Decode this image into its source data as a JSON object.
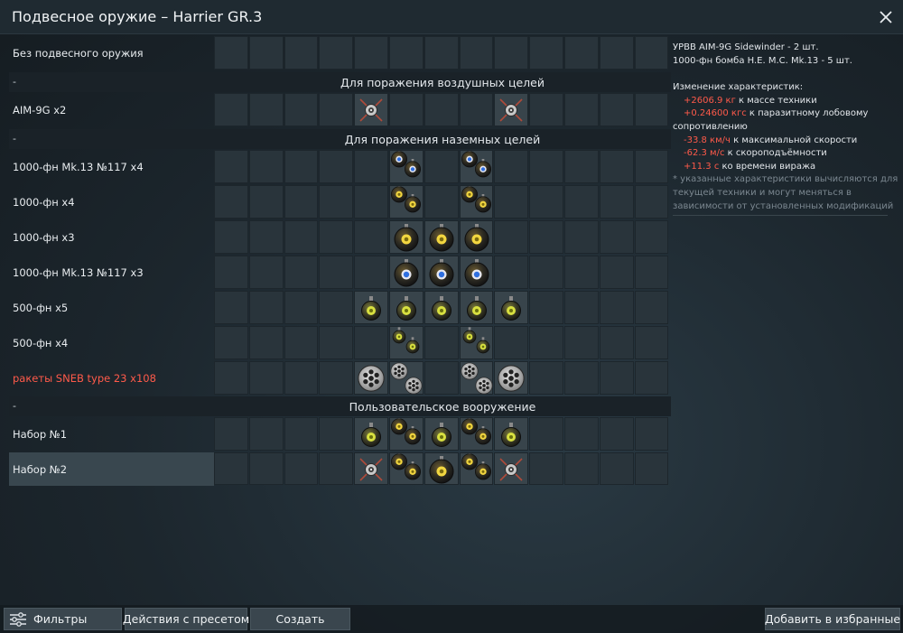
{
  "window": {
    "title": "Подвесное оружие – Harrier GR.3"
  },
  "rows": {
    "no_weapons": "Без подвесного оружия",
    "dash1": "-",
    "section_air": "Для поражения воздушных целей",
    "aim9g": "AIM-9G x2",
    "dash2": "-",
    "section_ground": "Для поражения наземных целей",
    "mk13_117_x4": "1000-фн Mk.13 №117 x4",
    "b1000_x4": "1000-фн x4",
    "b1000_x3": "1000-фн x3",
    "mk13_117_x3": "1000-фн Mk.13 №117 x3",
    "b500_x5": "500-фн x5",
    "b500_x4": "500-фн x4",
    "sneb": "ракеты SNEB type 23 x108",
    "dash3": "-",
    "section_custom": "Пользовательское вооружение",
    "set1": "Набор №1",
    "set2": "Набор №2"
  },
  "info": {
    "loadout_line1": "УРВВ AIM-9G Sidewinder - 2 шт.",
    "loadout_line2": "1000-фн бомба H.E. M.C. Mk.13 - 5 шт.",
    "changes_title": "Изменение характеристик:",
    "mass_value": "+2606.9 кг",
    "mass_text": " к массе техники",
    "drag_value": "+0.24600 кгс",
    "drag_text": " к паразитному лобовому",
    "drag_text2": "сопротивлению",
    "speed_value": "-33.8 км/ч",
    "speed_text": " к максимальной скорости",
    "climb_value": "-62.3 м/с",
    "climb_text": " к скороподъёмности",
    "turn_value": "+11.3 с",
    "turn_text": " ко времени виража",
    "note1": "* указанные характеристики вычисляются для",
    "note2": "текущей техники и могут меняться в",
    "note3": "зависимости от установленных модификаций"
  },
  "buttons": {
    "filters": "Фильтры",
    "preset_actions": "Действия с пресетом",
    "create": "Создать",
    "add_favorites": "Добавить в избранные"
  },
  "icons": {
    "close": "close-icon",
    "filters": "sliders-icon",
    "missile": "missile-icon",
    "bomb_1000": "bomb-1000-icon",
    "bomb_1000_pair": "bomb-1000-pair-icon",
    "bomb_mk13": "bomb-mk13-icon",
    "bomb_mk13_pair": "bomb-mk13-pair-icon",
    "bomb_500": "bomb-500-icon",
    "bomb_500_pair": "bomb-500-pair-icon",
    "rocket_pod": "rocket-pod-icon",
    "rocket_pod_pair": "rocket-pod-pair-icon"
  },
  "colors": {
    "accent_red": "#ff5a4a",
    "bomb_yellow": "#e8d040",
    "bomb_blue": "#3a78e0"
  }
}
